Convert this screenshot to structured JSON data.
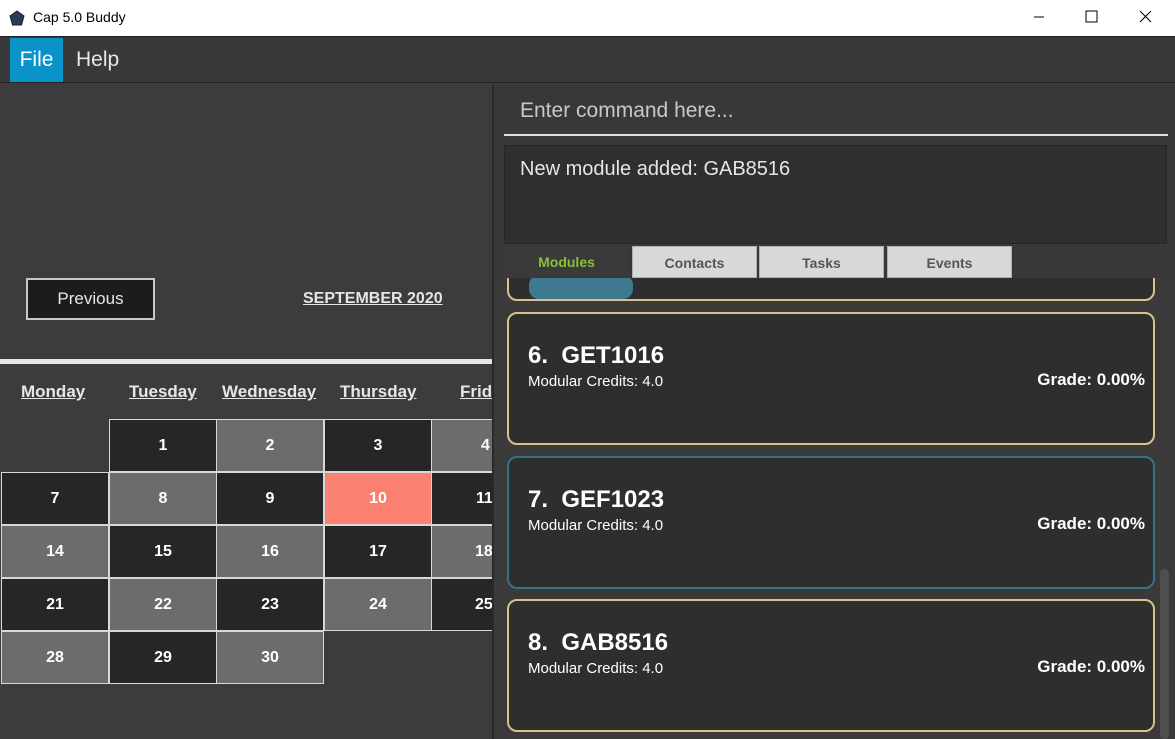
{
  "window": {
    "title": "Cap 5.0 Buddy"
  },
  "menu": {
    "file": "File",
    "help": "Help"
  },
  "calendar": {
    "previous_label": "Previous",
    "month_label": "SEPTEMBER 2020",
    "weekdays": [
      "Monday",
      "Tuesday",
      "Wednesday",
      "Thursday",
      "Frid"
    ],
    "today": "10",
    "days": [
      "1",
      "2",
      "3",
      "4",
      "7",
      "8",
      "9",
      "10",
      "11",
      "14",
      "15",
      "16",
      "17",
      "18",
      "21",
      "22",
      "23",
      "24",
      "25",
      "28",
      "29",
      "30"
    ]
  },
  "command": {
    "placeholder": "Enter command here...",
    "result": "New module added: GAB8516"
  },
  "tabs": [
    "Modules",
    "Contacts",
    "Tasks",
    "Events"
  ],
  "modules": [
    {
      "title": "6.  GET1016",
      "credits": "Modular Credits: 4.0",
      "grade": "Grade: 0.00%"
    },
    {
      "title": "7.  GEF1023",
      "credits": "Modular Credits: 4.0",
      "grade": "Grade: 0.00%"
    },
    {
      "title": "8.  GAB8516",
      "credits": "Modular Credits: 4.0",
      "grade": "Grade: 0.00%"
    }
  ],
  "colors": {
    "menu_active": "#0a93c8",
    "today": "#fa8072",
    "card_border": "#d9c08e",
    "card_selected_border": "#3a6f8f",
    "active_tab_text": "#8bbf3a"
  },
  "icons": {
    "app": "pentagon-app-icon",
    "minimize": "minimize-icon",
    "maximize": "maximize-icon",
    "close": "close-icon"
  }
}
